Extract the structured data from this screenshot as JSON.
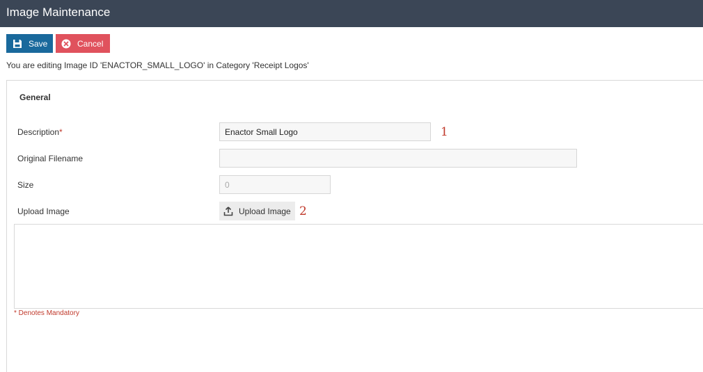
{
  "header": {
    "title": "Image Maintenance"
  },
  "toolbar": {
    "save_label": "Save",
    "cancel_label": "Cancel"
  },
  "info_text": "You are editing Image ID 'ENACTOR_SMALL_LOGO' in Category 'Receipt Logos'",
  "section": {
    "title": "General"
  },
  "fields": {
    "description": {
      "label": "Description",
      "required_marker": "*",
      "value": "Enactor Small Logo"
    },
    "original_filename": {
      "label": "Original Filename",
      "value": ""
    },
    "size": {
      "label": "Size",
      "value": "0"
    },
    "upload": {
      "label": "Upload Image",
      "button_label": "Upload Image"
    }
  },
  "annotations": {
    "one": "1",
    "two": "2"
  },
  "footer": {
    "mandatory_note": "* Denotes Mandatory"
  },
  "colors": {
    "header_bg": "#3b4656",
    "save_bg": "#19699c",
    "cancel_bg": "#e0525d",
    "required": "#c0392b"
  },
  "icons": {
    "save": "floppy-disk-icon",
    "cancel": "cancel-circle-icon",
    "upload": "upload-icon"
  }
}
